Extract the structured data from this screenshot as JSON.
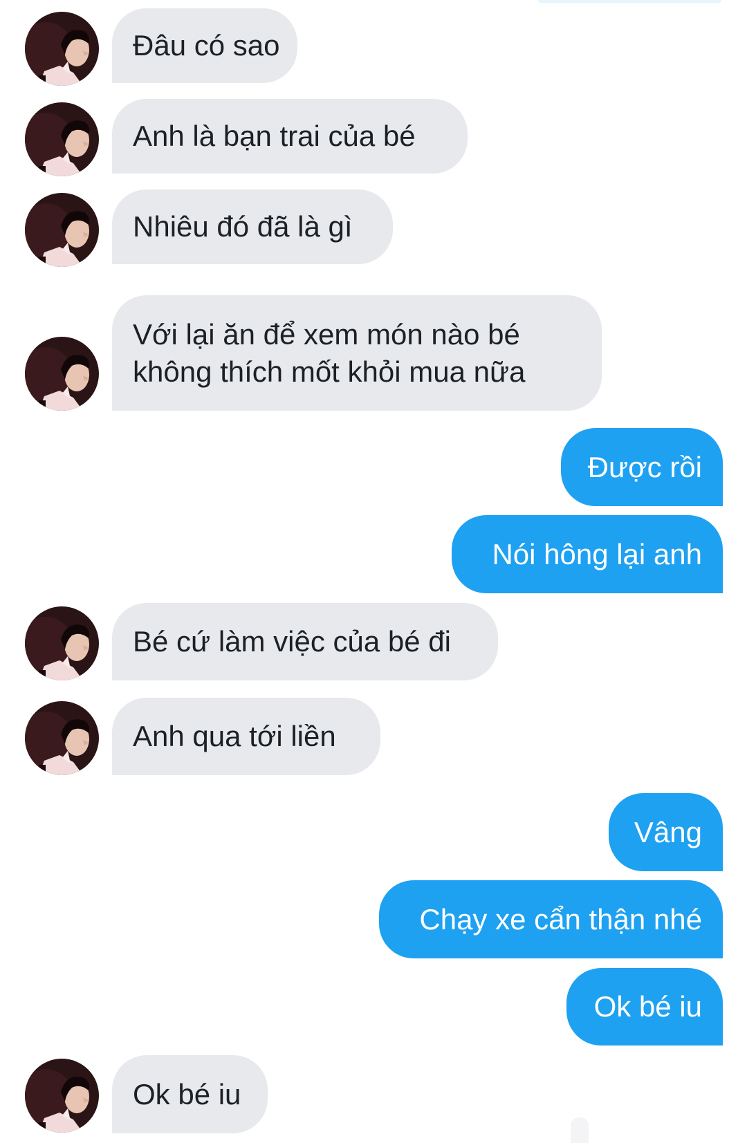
{
  "conversation": {
    "messages": [
      {
        "sender": "them",
        "text": "Đâu có sao"
      },
      {
        "sender": "them",
        "text": "Anh là bạn trai của bé"
      },
      {
        "sender": "them",
        "text": "Nhiêu đó đã là gì"
      },
      {
        "sender": "them",
        "lines": [
          "Với lại ăn để xem món nào bé",
          "không thích mốt khỏi mua nữa"
        ]
      },
      {
        "sender": "me",
        "text": "Được rồi"
      },
      {
        "sender": "me",
        "text": "Nói hông lại anh"
      },
      {
        "sender": "them",
        "text": "Bé cứ làm việc của bé đi"
      },
      {
        "sender": "them",
        "text": "Anh qua tới liền"
      },
      {
        "sender": "me",
        "text": "Vâng"
      },
      {
        "sender": "me",
        "text": "Chạy xe cẩn thận nhé"
      },
      {
        "sender": "me",
        "text": "Ok bé iu"
      },
      {
        "sender": "them",
        "text": "Ok bé iu"
      }
    ]
  },
  "colors": {
    "incoming_bubble": "#e7e9ec",
    "incoming_text": "#1c2127",
    "outgoing_bubble": "#1ea1f1",
    "outgoing_text": "#ffffff",
    "background": "#ffffff"
  },
  "icons": {
    "contact_avatar": "avatar-photo-icon"
  }
}
